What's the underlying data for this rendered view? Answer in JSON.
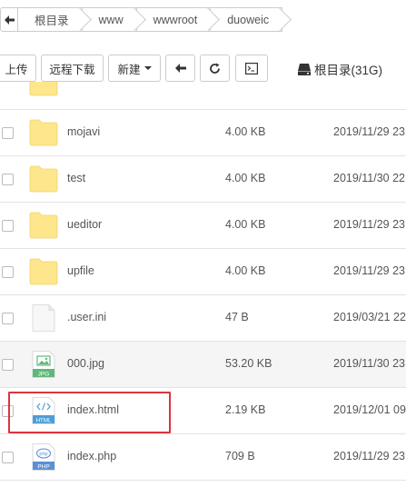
{
  "breadcrumb": {
    "items": [
      "根目录",
      "www",
      "wwwroot",
      "duoweic"
    ]
  },
  "toolbar": {
    "upload_label": "上传",
    "remote_download_label": "远程下载",
    "new_label": "新建",
    "root_disk_label": "根目录(31G)"
  },
  "files": [
    {
      "name": "mojavi",
      "size": "4.00 KB",
      "date": "2019/11/29 23",
      "type": "folder"
    },
    {
      "name": "test",
      "size": "4.00 KB",
      "date": "2019/11/30 22",
      "type": "folder"
    },
    {
      "name": "ueditor",
      "size": "4.00 KB",
      "date": "2019/11/29 23",
      "type": "folder"
    },
    {
      "name": "upfile",
      "size": "4.00 KB",
      "date": "2019/11/29 23",
      "type": "folder"
    },
    {
      "name": ".user.ini",
      "size": "47 B",
      "date": "2019/03/21 22",
      "type": "file"
    },
    {
      "name": "000.jpg",
      "size": "53.20 KB",
      "date": "2019/11/30 23",
      "type": "jpg",
      "badge": "JPG"
    },
    {
      "name": "index.html",
      "size": "2.19 KB",
      "date": "2019/12/01 09",
      "type": "html",
      "badge": "HTML"
    },
    {
      "name": "index.php",
      "size": "709 B",
      "date": "2019/11/29 23",
      "type": "php",
      "badge": "PHP"
    }
  ],
  "colors": {
    "folder": "#fde68b",
    "highlight_box": "#d9363e",
    "jpg_badge": "#5fb878",
    "html_badge": "#4a9fd8",
    "php_badge": "#5b8fd6"
  }
}
